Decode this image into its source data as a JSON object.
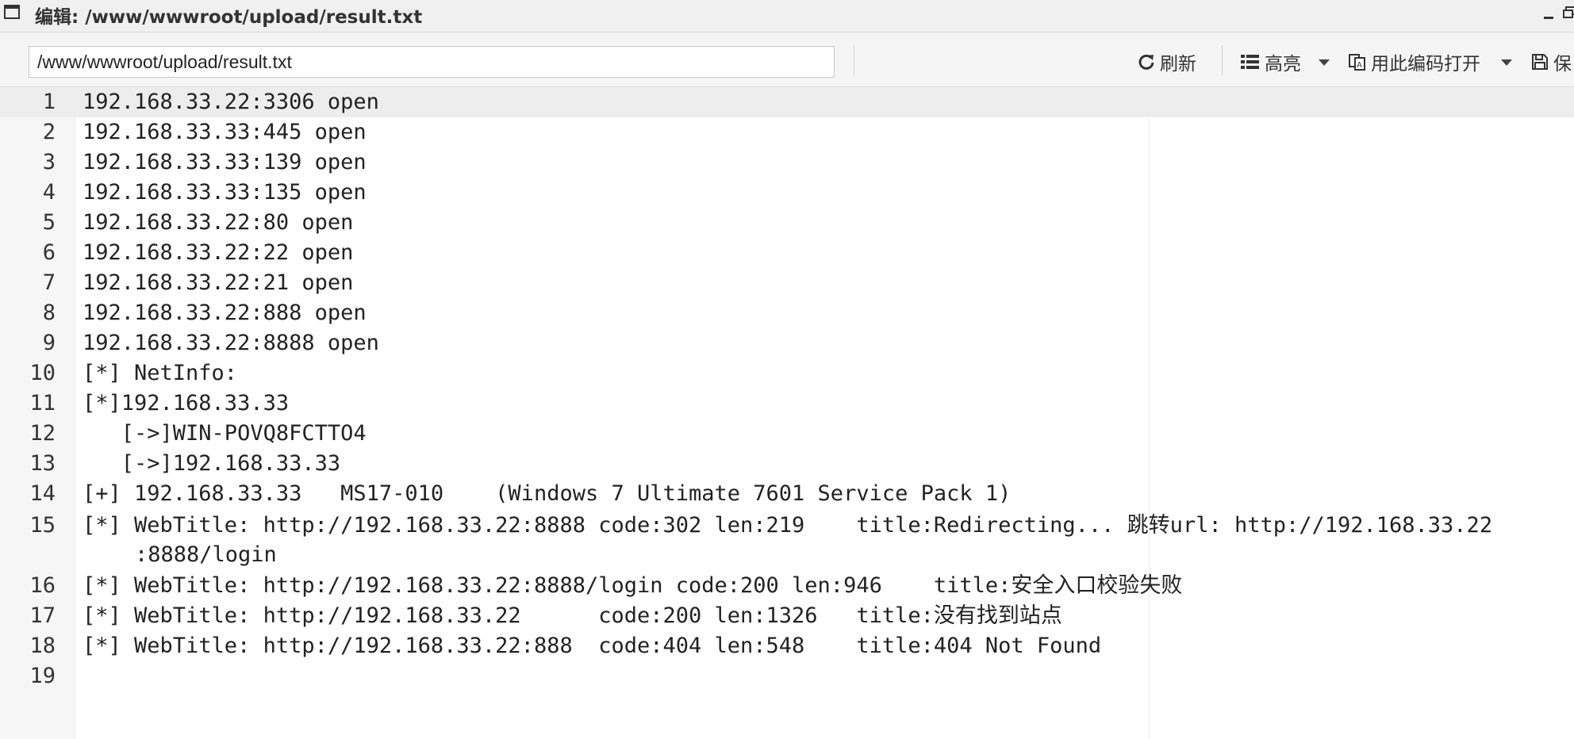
{
  "window": {
    "title": "编辑: /www/wwwroot/upload/result.txt"
  },
  "toolbar": {
    "path_value": "/www/wwwroot/upload/result.txt",
    "refresh_label": "刷新",
    "highlight_label": "高亮",
    "encoding_label": "用此编码打开",
    "save_label": "保"
  },
  "editor": {
    "lines": [
      {
        "num": "1",
        "text": "192.168.33.22:3306 open"
      },
      {
        "num": "2",
        "text": "192.168.33.33:445 open"
      },
      {
        "num": "3",
        "text": "192.168.33.33:139 open"
      },
      {
        "num": "4",
        "text": "192.168.33.33:135 open"
      },
      {
        "num": "5",
        "text": "192.168.33.22:80 open"
      },
      {
        "num": "6",
        "text": "192.168.33.22:22 open"
      },
      {
        "num": "7",
        "text": "192.168.33.22:21 open"
      },
      {
        "num": "8",
        "text": "192.168.33.22:888 open"
      },
      {
        "num": "9",
        "text": "192.168.33.22:8888 open"
      },
      {
        "num": "10",
        "text": "[*] NetInfo:"
      },
      {
        "num": "11",
        "text": "[*]192.168.33.33"
      },
      {
        "num": "12",
        "text": "   [->]WIN-POVQ8FCTTO4"
      },
      {
        "num": "13",
        "text": "   [->]192.168.33.33"
      },
      {
        "num": "14",
        "text": "[+] 192.168.33.33   MS17-010    (Windows 7 Ultimate 7601 Service Pack 1)"
      },
      {
        "num": "15",
        "text": "[*] WebTitle: http://192.168.33.22:8888 code:302 len:219    title:Redirecting... 跳转url: http://192.168.33.22",
        "cont": ":8888/login"
      },
      {
        "num": "16",
        "text": "[*] WebTitle: http://192.168.33.22:8888/login code:200 len:946    title:安全入口校验失败"
      },
      {
        "num": "17",
        "text": "[*] WebTitle: http://192.168.33.22      code:200 len:1326   title:没有找到站点"
      },
      {
        "num": "18",
        "text": "[*] WebTitle: http://192.168.33.22:888  code:404 len:548    title:404 Not Found"
      },
      {
        "num": "19",
        "text": ""
      }
    ]
  }
}
